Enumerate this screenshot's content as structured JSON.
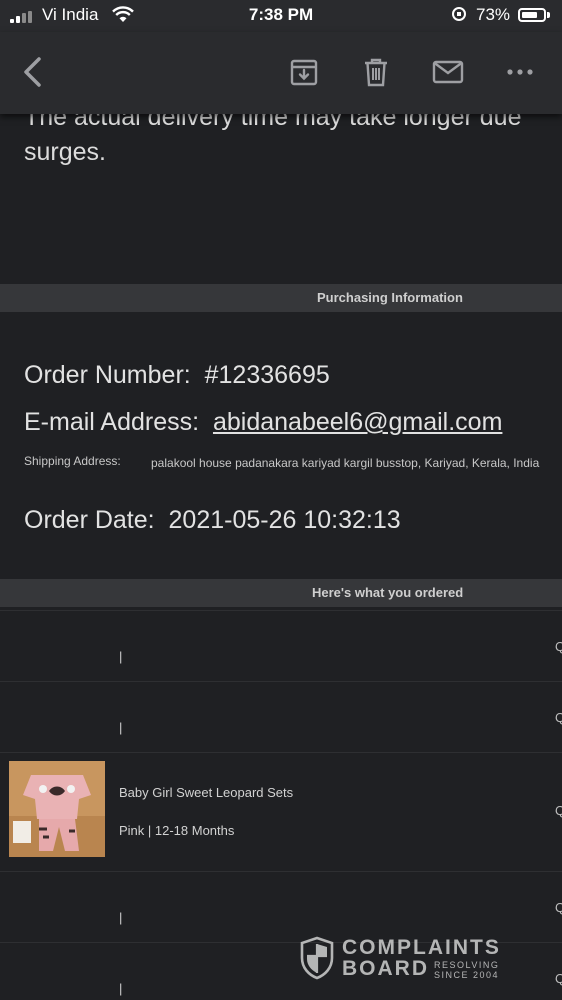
{
  "status_bar": {
    "carrier": "Vi India",
    "time": "7:38 PM",
    "battery_percent": "73%",
    "battery_level": 0.73
  },
  "toolbar": {
    "icons": [
      "back-icon",
      "archive-icon",
      "trash-icon",
      "mail-icon",
      "more-icon"
    ]
  },
  "email": {
    "intro_text_line1": "The actual delivery time may take longer due",
    "intro_text_line2": "surges.",
    "purchasing_header": "Purchasing Information",
    "order_number_label": "Order Number:",
    "order_number": "#12336695",
    "email_label": "E-mail Address:",
    "email_value": "abidanabeel6@gmail.com",
    "shipping_label": "Shipping Address:",
    "shipping_value": "palakool house padanakara kariyad kargil busstop, Kariyad, Kerala, India",
    "order_date_label": "Order Date:",
    "order_date": "2021-05-26 10:32:13",
    "ordered_header": "Here's what you ordered",
    "items": [
      {
        "name": "",
        "variant": "|",
        "edge": "Q"
      },
      {
        "name": "",
        "variant": "|",
        "edge": "Q"
      },
      {
        "name": "Baby Girl Sweet Leopard Sets",
        "variant": "Pink | 12-18 Months",
        "edge": "Q"
      },
      {
        "name": "",
        "variant": "|",
        "edge": "Q"
      },
      {
        "name": "",
        "variant": "|",
        "edge": "Q"
      }
    ]
  },
  "watermark": {
    "line1": "COMPLAINTS",
    "line2": "BOARD",
    "tag1": "RESOLVING",
    "tag2": "SINCE 2004"
  }
}
